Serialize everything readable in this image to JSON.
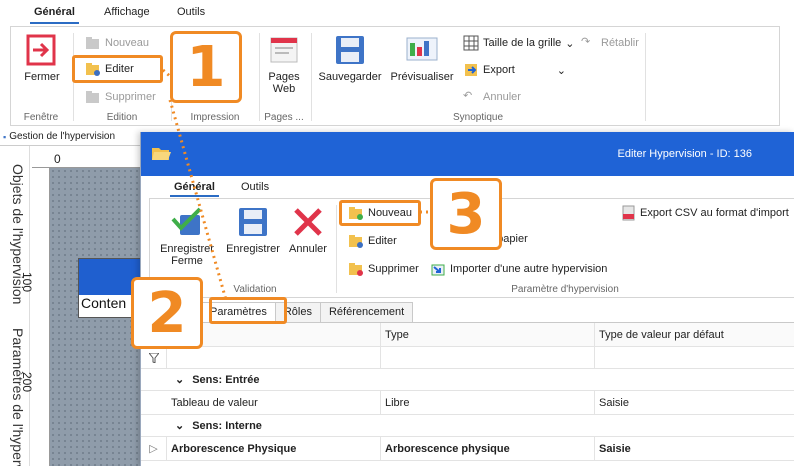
{
  "main_ribbon": {
    "tabs": [
      "Général",
      "Affichage",
      "Outils"
    ],
    "fenetre": {
      "label": "Fenêtre",
      "fermer": "Fermer"
    },
    "edition": {
      "label": "Edition",
      "nouveau": "Nouveau",
      "editer": "Editer",
      "supprimer": "Supprimer"
    },
    "impression": {
      "label": "Impression"
    },
    "pages": {
      "label": "Pages ...",
      "pages_web": "Pages\nWeb"
    },
    "synoptique": {
      "label": "Synoptique",
      "sauvegarder": "Sauvegarder",
      "previsualiser": "Prévisualiser",
      "taille_grille": "Taille de la grille",
      "retablir": "Rétablir",
      "export": "Export",
      "annuler": "Annuler"
    }
  },
  "document": {
    "tab_title": "Gestion de l'hypervision",
    "side_labels": [
      "Objets de l'hypervision",
      "Paramètres de l'hypervi"
    ],
    "ruler_top": "0",
    "ruler_left": [
      "100",
      "200"
    ],
    "content_label": "Conten"
  },
  "dialog": {
    "title": "Editer Hypervision - ID: 136",
    "tabs": [
      "Général",
      "Outils"
    ],
    "validation": {
      "label": "Validation",
      "enregistrer_fermer": "Enregistrer\nFerme",
      "enregistrer": "Enregistrer",
      "annuler": "Annuler"
    },
    "parametre": {
      "label": "Paramètre d'hypervision",
      "nouveau": "Nouveau",
      "editer": "Editer",
      "supprimer": "Supprimer",
      "export_csv": "Export CSV au format d'import",
      "papier": "e papier",
      "importer": "Importer d'une autre hypervision"
    },
    "sub_tabs": [
      "Paramètres",
      "Rôles",
      "Référencement"
    ],
    "grid": {
      "headers": [
        "ètre",
        "Type",
        "Type de valeur par défaut"
      ],
      "sections": [
        {
          "title": "Sens: Entrée",
          "rows": [
            [
              "Tableau de valeur",
              "Libre",
              "Saisie"
            ]
          ]
        },
        {
          "title": "Sens: Interne",
          "rows": [
            [
              "Arborescence Physique",
              "Arborescence physique",
              "Saisie"
            ]
          ]
        }
      ]
    }
  },
  "callouts": [
    "1",
    "2",
    "3"
  ],
  "colors": {
    "accent": "#f08a24",
    "title_bar": "#1f63d6",
    "canvas_block": "#1f5fcf"
  }
}
